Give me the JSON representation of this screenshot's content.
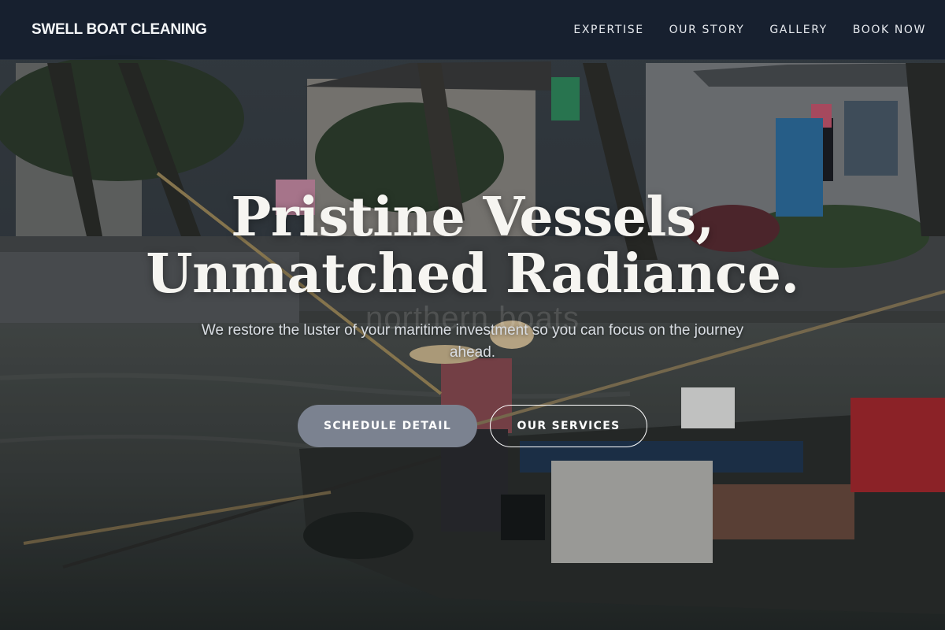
{
  "brand": {
    "name": "SWELL BOAT CLEANING"
  },
  "nav": {
    "items": [
      {
        "label": "EXPERTISE"
      },
      {
        "label": "OUR STORY"
      },
      {
        "label": "GALLERY"
      },
      {
        "label": "BOOK NOW"
      }
    ]
  },
  "hero": {
    "title_line1": "Pristine Vessels,",
    "title_line2": "Unmatched Radiance.",
    "watermark": "northern boats",
    "subtitle": "We restore the luster of your maritime investment so you can focus on the journey ahead.",
    "primary_cta": "SCHEDULE DETAIL",
    "secondary_cta": "OUR SERVICES"
  },
  "colors": {
    "navbar": "#161e2e",
    "primary_button": "#7b8290",
    "title_text": "#f6f5f1"
  }
}
